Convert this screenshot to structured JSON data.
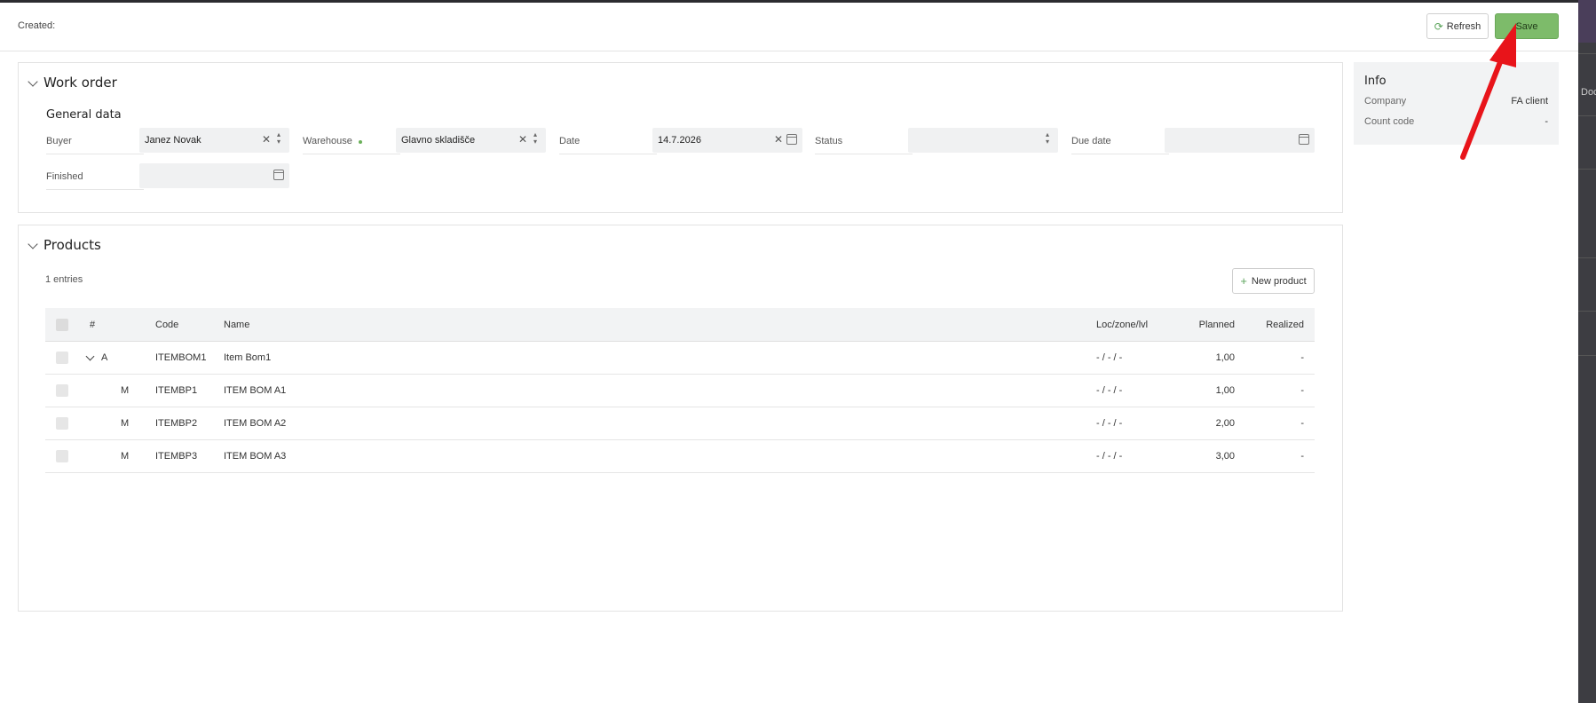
{
  "header": {
    "created_label": "Created:",
    "refresh_label": "Refresh",
    "save_label": "Save"
  },
  "work_order": {
    "title": "Work order",
    "subtitle": "General data",
    "fields": {
      "buyer_label": "Buyer",
      "buyer_value": "Janez Novak",
      "warehouse_label": "Warehouse",
      "warehouse_value": "Glavno skladišče",
      "date_label": "Date",
      "date_value": "14.7.2026",
      "status_label": "Status",
      "status_value": "",
      "due_date_label": "Due date",
      "due_date_value": "",
      "finished_label": "Finished",
      "finished_value": ""
    }
  },
  "products": {
    "title": "Products",
    "entries_label": "1 entries",
    "new_product_label": "New product",
    "columns": {
      "num": "#",
      "code": "Code",
      "name": "Name",
      "loc": "Loc/zone/lvl",
      "planned": "Planned",
      "realized": "Realized"
    },
    "rows": [
      {
        "num": "A",
        "code": "ITEMBOM1",
        "name": "Item Bom1",
        "loc": "- / - / -",
        "planned": "1,00",
        "realized": "-"
      },
      {
        "num": "M",
        "code": "ITEMBP1",
        "name": "ITEM BOM A1",
        "loc": "- / - / -",
        "planned": "1,00",
        "realized": "-"
      },
      {
        "num": "M",
        "code": "ITEMBP2",
        "name": "ITEM BOM A2",
        "loc": "- / - / -",
        "planned": "2,00",
        "realized": "-"
      },
      {
        "num": "M",
        "code": "ITEMBP3",
        "name": "ITEM BOM A3",
        "loc": "- / - / -",
        "planned": "3,00",
        "realized": "-"
      }
    ]
  },
  "info": {
    "title": "Info",
    "company_label": "Company",
    "company_value": "FA client",
    "count_code_label": "Count code",
    "count_code_value": "-"
  },
  "background": {
    "side_text": "Docu"
  },
  "icons": {
    "refresh": "refresh-icon",
    "clear": "clear-icon",
    "updown": "updown-icon",
    "calendar": "calendar-icon",
    "plus": "plus-icon",
    "chevron": "chevron-down-icon"
  },
  "colors": {
    "accent": "#7dbb6a",
    "annotation_arrow": "#e8141a"
  }
}
